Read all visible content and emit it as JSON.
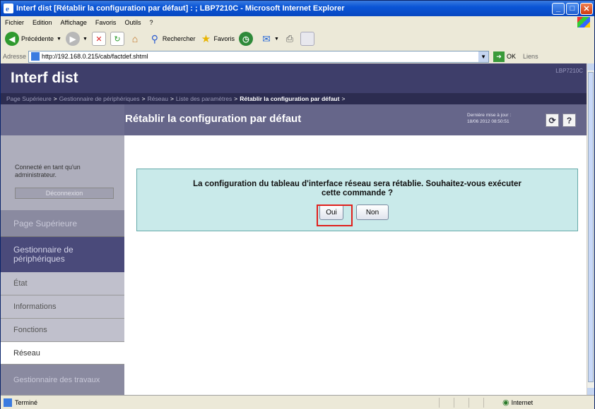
{
  "window": {
    "title": "Interf dist [Rétablir la configuration par défaut] : ; LBP7210C - Microsoft Internet Explorer"
  },
  "menu": [
    "Fichier",
    "Edition",
    "Affichage",
    "Favoris",
    "Outils",
    "?"
  ],
  "toolbar": {
    "back_label": "Précédente",
    "search_label": "Rechercher",
    "favorites_label": "Favoris"
  },
  "address": {
    "label": "Adresse",
    "url": "http://192.168.0.215/cab/factdef.shtml",
    "go_label": "OK",
    "links_label": "Liens"
  },
  "page": {
    "logo": "Interf dist",
    "model": "LBP7210C",
    "breadcrumb": [
      "Page Supérieure",
      "Gestionnaire de périphériques",
      "Réseau",
      "Liste des paramètres"
    ],
    "breadcrumb_current": "Rétablir la configuration par défaut",
    "title": "Rétablir la configuration par défaut",
    "last_update_label": "Dernière mise à jour :",
    "last_update_value": "18/06 2012 08:50:51"
  },
  "sidebar": {
    "login_status": "Connecté en tant qu'un administrateur.",
    "logout_label": "Déconnexion",
    "items": [
      {
        "label": "Page Supérieure"
      },
      {
        "label": "Gestionnaire de périphériques"
      },
      {
        "label": "État"
      },
      {
        "label": "Informations"
      },
      {
        "label": "Fonctions"
      },
      {
        "label": "Réseau"
      },
      {
        "label": "Gestionnaire des travaux"
      }
    ]
  },
  "dialog": {
    "line1": "La configuration du tableau d'interface réseau sera rétablie. Souhaitez-vous exécuter",
    "line2": "cette commande ?",
    "yes_label": "Oui",
    "no_label": "Non"
  },
  "statusbar": {
    "left": "Terminé",
    "zone": "Internet"
  }
}
